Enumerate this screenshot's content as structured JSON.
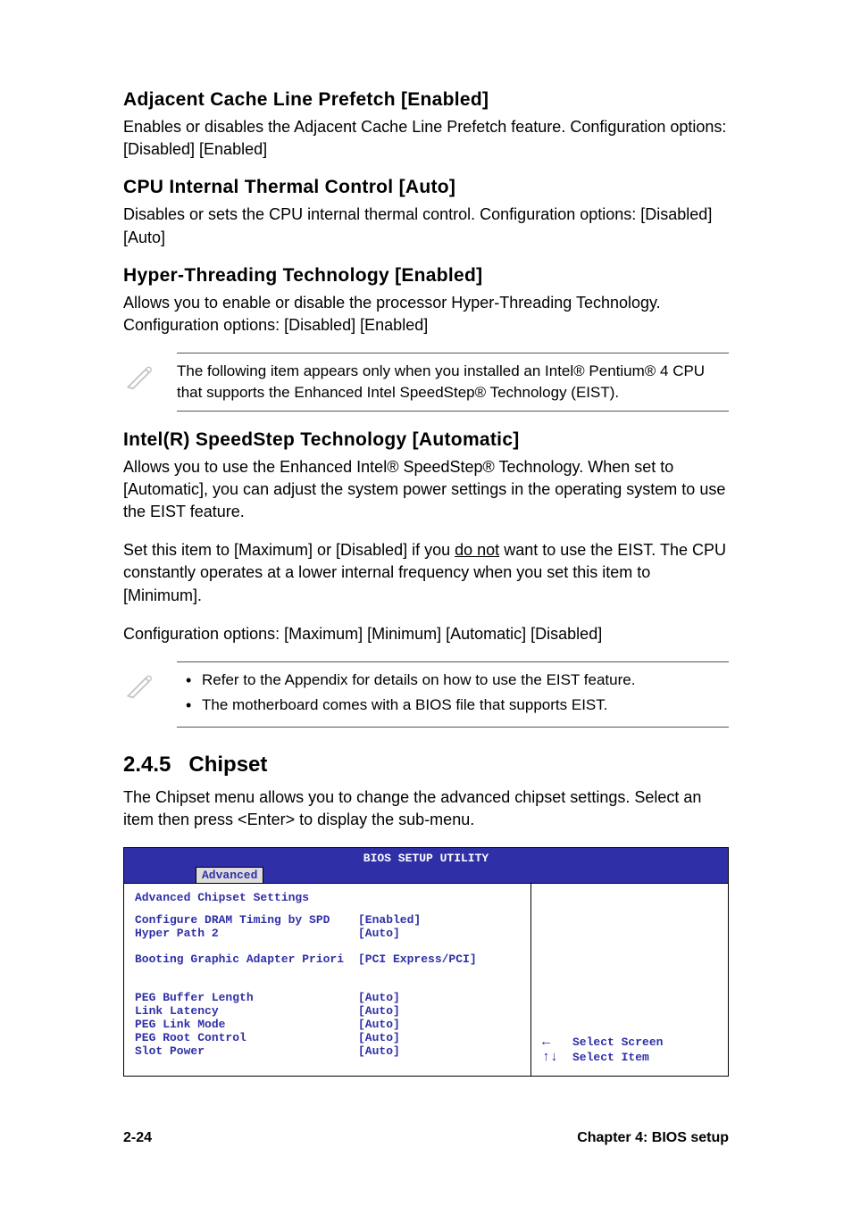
{
  "sections": {
    "adj_cache": {
      "heading": "Adjacent Cache Line Prefetch [Enabled]",
      "text": "Enables or disables the Adjacent Cache Line Prefetch feature. Configuration options: [Disabled] [Enabled]"
    },
    "cpu_thermal": {
      "heading": "CPU Internal Thermal Control [Auto]",
      "text": "Disables or sets the CPU internal thermal control. Configuration options: [Disabled] [Auto]"
    },
    "hyper_threading": {
      "heading": "Hyper-Threading Technology [Enabled]",
      "text": "Allows you to enable or disable the processor Hyper-Threading Technology. Configuration options: [Disabled] [Enabled]"
    },
    "note1": {
      "text": "The following item appears only when you installed an Intel® Pentium® 4 CPU that supports the Enhanced Intel SpeedStep® Technology (EIST)."
    },
    "speedstep": {
      "heading": "Intel(R) SpeedStep Technology [Automatic]",
      "p1": "Allows you to use the Enhanced Intel® SpeedStep® Technology. When set to [Automatic], you can adjust the system power settings in the operating system to use the EIST feature.",
      "p2_pre": "Set this item to [Maximum] or [Disabled] if you ",
      "p2_under": "do not",
      "p2_post": " want to use the EIST. The CPU constantly operates at a lower internal frequency when you set this item to [Minimum].",
      "p3": "Configuration options: [Maximum] [Minimum] [Automatic] [Disabled]"
    },
    "note2": {
      "b1": "Refer to the Appendix for details on how to use the EIST feature.",
      "b2": "The motherboard comes with a BIOS file that supports EIST."
    },
    "chipset": {
      "num": "2.4.5",
      "title": "Chipset",
      "text": "The Chipset menu allows you to change the advanced chipset settings. Select an item then press <Enter> to display the sub-menu."
    }
  },
  "bios": {
    "title": "BIOS SETUP UTILITY",
    "tab": "Advanced",
    "section_title": "Advanced Chipset Settings",
    "rows": {
      "r1": {
        "label": "Configure DRAM Timing by SPD",
        "value": "[Enabled]"
      },
      "r2": {
        "label": "Hyper Path 2",
        "value": "[Auto]"
      },
      "r3": {
        "label": "Booting Graphic Adapter Priori",
        "value": "[PCI Express/PCI]"
      },
      "r4": {
        "label": "PEG Buffer Length",
        "value": "[Auto]"
      },
      "r5": {
        "label": "Link Latency",
        "value": "[Auto]"
      },
      "r6": {
        "label": "PEG Link Mode",
        "value": "[Auto]"
      },
      "r7": {
        "label": "PEG Root Control",
        "value": "[Auto]"
      },
      "r8": {
        "label": "Slot Power",
        "value": "[Auto]"
      }
    },
    "hints": {
      "h1": "Select Screen",
      "h2": "Select Item"
    }
  },
  "footer": {
    "page": "2-24",
    "chapter": "Chapter 4: BIOS setup"
  }
}
